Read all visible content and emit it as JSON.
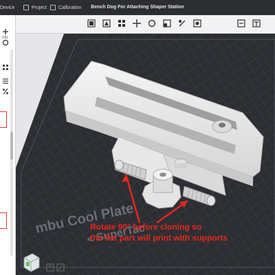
{
  "window": {
    "title": "Bench Dog For Attaching Shaper Station"
  },
  "tabs": [
    {
      "label": "Device",
      "icon": "device-icon"
    },
    {
      "label": "Project",
      "icon": "project-icon"
    },
    {
      "label": "Calibration",
      "icon": "calibration-icon"
    }
  ],
  "toolbar": {
    "icons": [
      "add-plate-icon",
      "orient-icon",
      "arrange-icon",
      "move-icon",
      "rotate-icon",
      "scale-icon",
      "split-icon",
      "support-paint-icon",
      "fuzzy-skin-icon",
      "text-icon"
    ]
  },
  "left_panel": {
    "label": "nfo",
    "icons": [
      "plus-icon",
      "settings-icon",
      "grid-icon",
      "percent-icon"
    ]
  },
  "plate": {
    "label_text": "mbu Cool Plate",
    "label_text2": "< SuperTac"
  },
  "annotation": {
    "line1": "Rotate 90° before cloning so",
    "line2": "the flat part will print with supports",
    "color": "#e8271a"
  },
  "colors": {
    "plate": "#2d2f33",
    "grid": "#3c3f44",
    "model": "#ececec",
    "background": "#e6e6e8"
  }
}
